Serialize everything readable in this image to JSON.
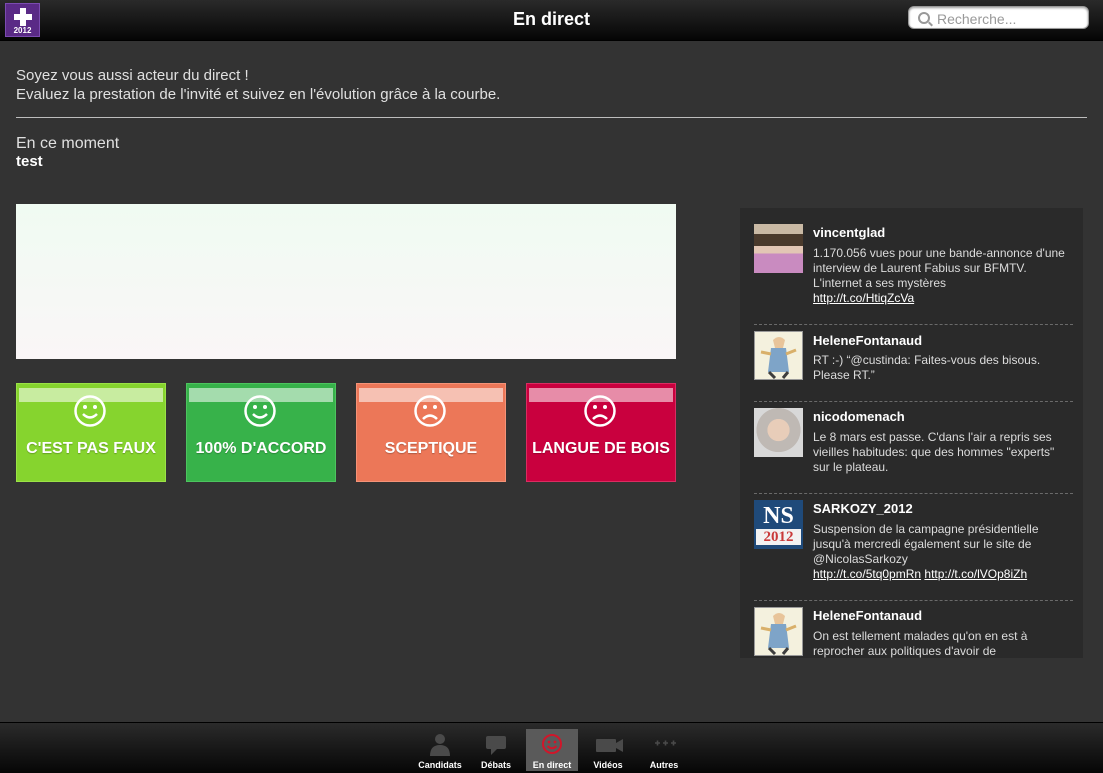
{
  "app": {
    "logo_text": "2012",
    "title": "En direct"
  },
  "search": {
    "placeholder": "Recherche..."
  },
  "intro": {
    "line1": "Soyez vous aussi acteur du direct !",
    "line2": "Evaluez la prestation de l'invité et suivez en l'évolution grâce à la courbe."
  },
  "moment": {
    "label": "En ce moment",
    "value": "test"
  },
  "votes": [
    {
      "label": "C'EST PAS FAUX",
      "color": "#86d42e",
      "mood": "happy"
    },
    {
      "label": "100% D'ACCORD",
      "color": "#37b24a",
      "mood": "happy"
    },
    {
      "label": "SCEPTIQUE",
      "color": "#ec7758",
      "mood": "sad"
    },
    {
      "label": "LANGUE DE BOIS",
      "color": "#c9003e",
      "mood": "sad"
    }
  ],
  "tweets": [
    {
      "user": "vincentglad",
      "text": "1.170.056 vues pour une bande-annonce d'une interview de Laurent Fabius sur BFMTV. L'internet a ses mystères",
      "links": [
        "http://t.co/HtiqZcVa"
      ]
    },
    {
      "user": "HeleneFontanaud",
      "text": "RT :-) “@custinda: Faites-vous des bisous. Please RT.”",
      "links": []
    },
    {
      "user": "nicodomenach",
      "text": "Le 8 mars est passe. C'dans l'air a repris ses vieilles habitudes: que des hommes \"experts\" sur le plateau.",
      "links": []
    },
    {
      "user": "SARKOZY_2012",
      "avatar_text": "NS",
      "avatar_year": "2012",
      "text": "Suspension de la campagne présidentielle jusqu'à mercredi également sur le site de @NicolasSarkozy",
      "links": [
        "http://t.co/5tq0pmRn",
        "http://t.co/lVOp8iZh"
      ]
    },
    {
      "user": "HeleneFontanaud",
      "text": "On est tellement malades qu'on en est à reprocher aux politiques d'avoir de",
      "links": []
    }
  ],
  "tabs": [
    {
      "label": "Candidats",
      "icon": "person-icon",
      "active": false
    },
    {
      "label": "Débats",
      "icon": "speech-bubble-icon",
      "active": false
    },
    {
      "label": "En direct",
      "icon": "smiley-icon",
      "active": true
    },
    {
      "label": "Vidéos",
      "icon": "video-camera-icon",
      "active": false
    },
    {
      "label": "Autres",
      "icon": "more-dots-icon",
      "active": false
    }
  ]
}
